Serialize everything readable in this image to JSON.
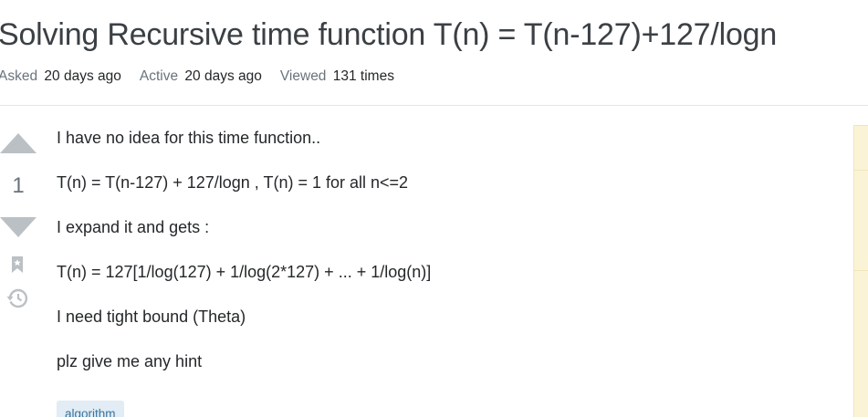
{
  "question": {
    "title": "Solving Recursive time function T(n) = T(n-127)+127/logn",
    "meta": {
      "asked_label": "Asked",
      "asked_value": "20 days ago",
      "active_label": "Active",
      "active_value": "20 days ago",
      "viewed_label": "Viewed",
      "viewed_value": "131 times"
    },
    "votes": "1",
    "body": [
      "I have no idea for this time function..",
      "T(n) = T(n-127) + 127/logn , T(n) = 1 for all n<=2",
      "I expand it and gets :",
      "T(n) = 127[1/log(127) + 1/log(2*127) + ... + 1/log(n)]",
      "I need tight bound (Theta)",
      "plz give me any hint"
    ],
    "tags": [
      "algorithm"
    ]
  },
  "icons": {
    "upvote": "arrow-up-icon",
    "downvote": "arrow-down-icon",
    "bookmark": "bookmark-icon",
    "history": "history-icon"
  },
  "colors": {
    "vote_arrow": "#bbc0c4",
    "tag_bg": "#e1ecf4",
    "tag_text": "#39739d",
    "sidebar_bg": "#fbf3d5"
  }
}
